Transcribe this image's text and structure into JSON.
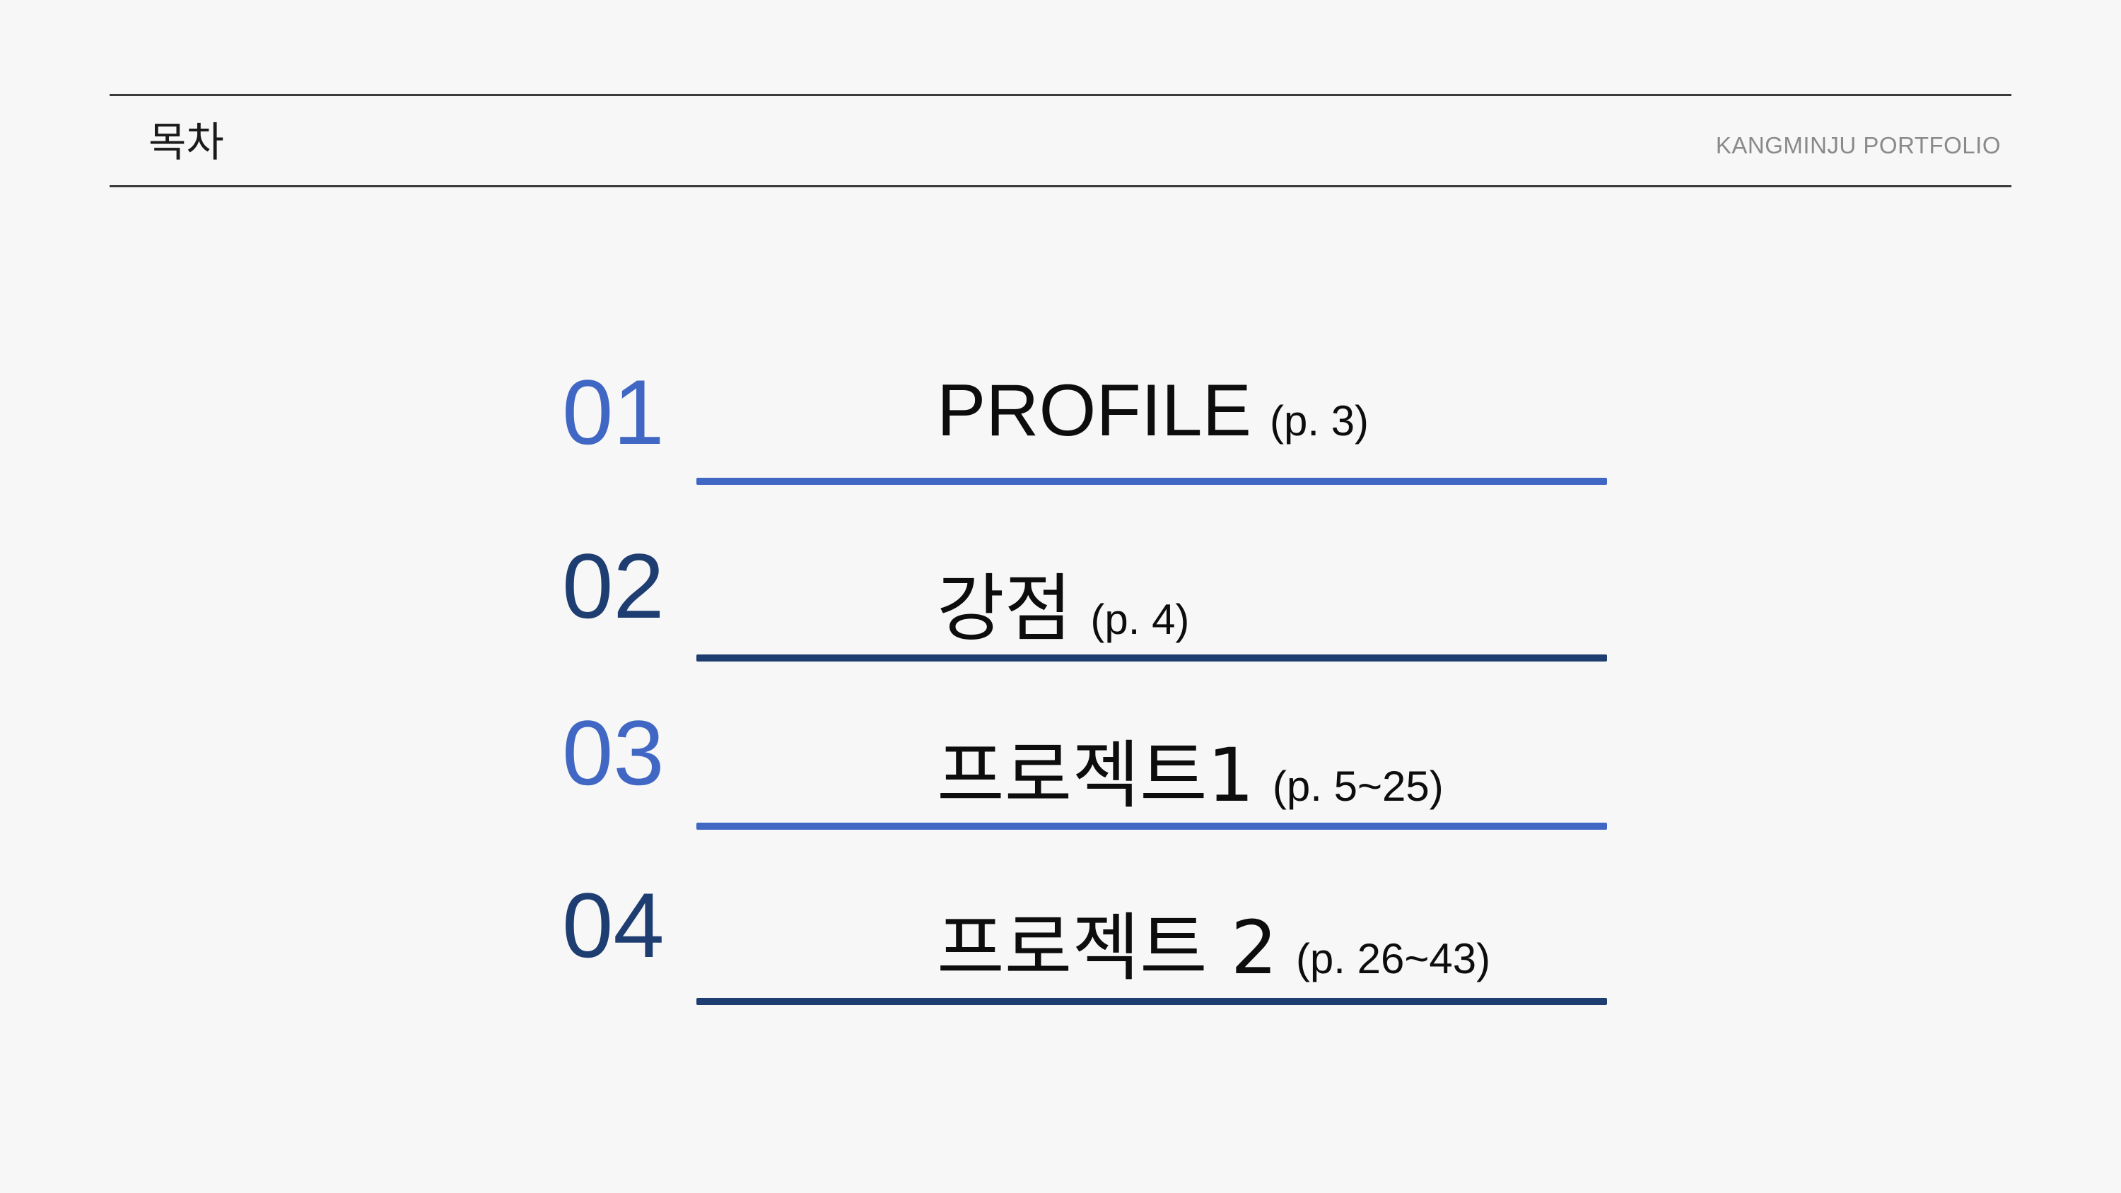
{
  "header": {
    "title": "목차",
    "brand": "KANGMINJU PORTFOLIO"
  },
  "colors": {
    "accent_light": "#4067c4",
    "accent_dark": "#1e3e72",
    "rule": "#3a3a3a",
    "background": "#f7f7f7"
  },
  "toc": [
    {
      "number": "01",
      "title": "PROFILE",
      "pages": "(p. 3)"
    },
    {
      "number": "02",
      "title": "강점",
      "pages": "(p. 4)"
    },
    {
      "number": "03",
      "title": "프로젝트1",
      "pages": "(p. 5~25)"
    },
    {
      "number": "04",
      "title": "프로젝트 2",
      "pages": "(p. 26~43)"
    }
  ]
}
